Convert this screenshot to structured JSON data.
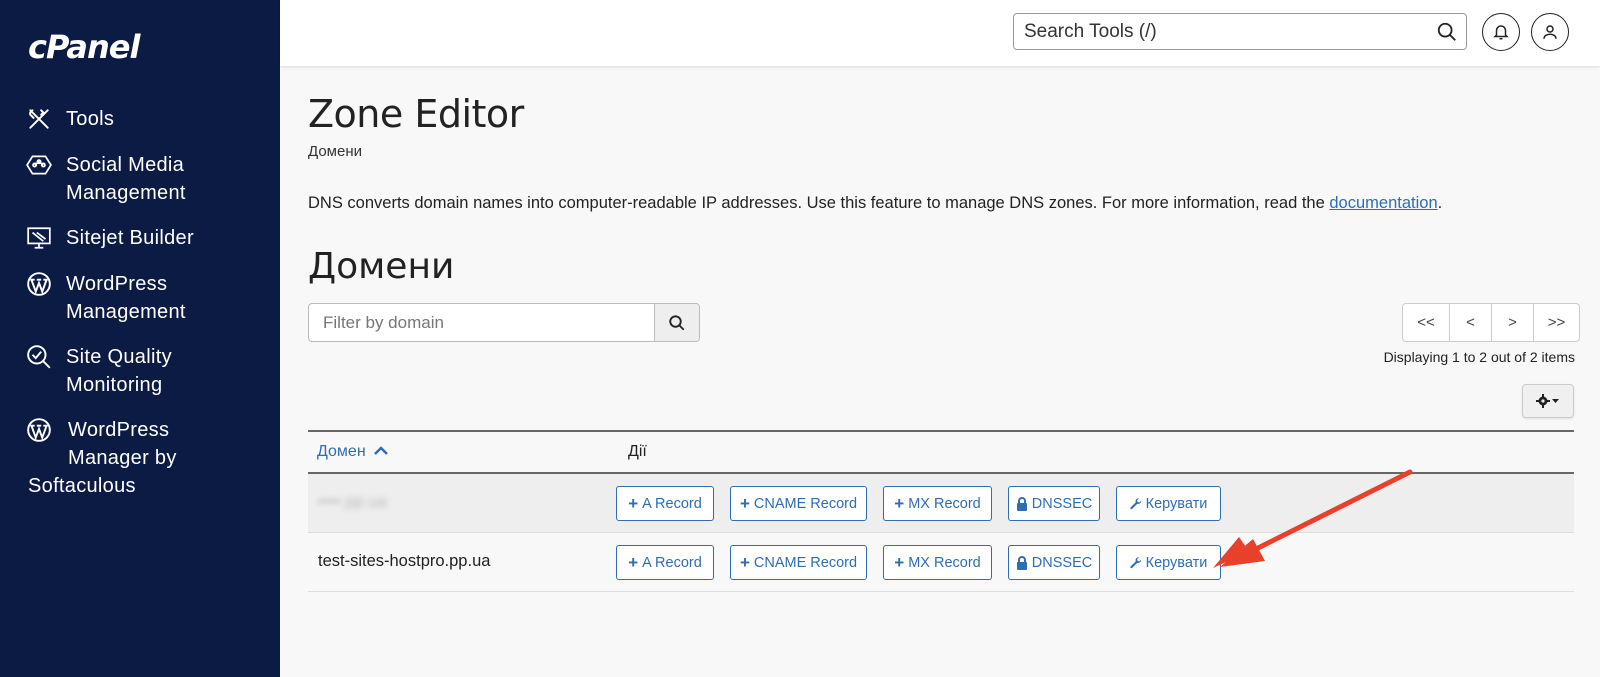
{
  "sidebar": {
    "logo": "cPanel",
    "items": [
      {
        "label_lines": [
          "Tools"
        ],
        "icon": "tools-icon"
      },
      {
        "label_lines": [
          "Social Media",
          "Management"
        ],
        "icon": "social-media-icon"
      },
      {
        "label_lines": [
          "Sitejet Builder"
        ],
        "icon": "sitejet-icon"
      },
      {
        "label_lines": [
          "WordPress",
          "Management"
        ],
        "icon": "wordpress-icon"
      },
      {
        "label_lines": [
          "Site Quality",
          "Monitoring"
        ],
        "icon": "site-quality-icon"
      },
      {
        "label_lines": [
          "WordPress",
          "Manager by",
          "Softaculous"
        ],
        "icon": "wordpress-icon"
      }
    ]
  },
  "header": {
    "search_placeholder": "Search Tools (/)"
  },
  "page": {
    "title": "Zone Editor",
    "breadcrumb": "Домени",
    "description": "DNS converts domain names into computer-readable IP addresses. Use this feature to manage DNS zones. For more information, read the",
    "doc_link": "documentation",
    "desc_end": ".",
    "section_title": "Домени",
    "filter_placeholder": "Filter by domain",
    "pager": [
      "<<",
      "<",
      ">",
      ">>"
    ],
    "display_count": "Displaying 1 to 2 out of 2 items"
  },
  "table": {
    "col_domain": "Домен",
    "col_actions": "Дії",
    "rows": [
      {
        "domain": "••••.pp.ua",
        "blurred": true
      },
      {
        "domain": "test-sites-hostpro.pp.ua",
        "blurred": false
      }
    ],
    "actions": {
      "a_record": "A Record",
      "cname_record": "CNAME Record",
      "mx_record": "MX Record",
      "dnssec": "DNSSEC",
      "manage": "Керувати"
    }
  },
  "colors": {
    "sidebar_bg": "#0c1b44",
    "link": "#2e6db4",
    "arrow": "#e8402a"
  }
}
